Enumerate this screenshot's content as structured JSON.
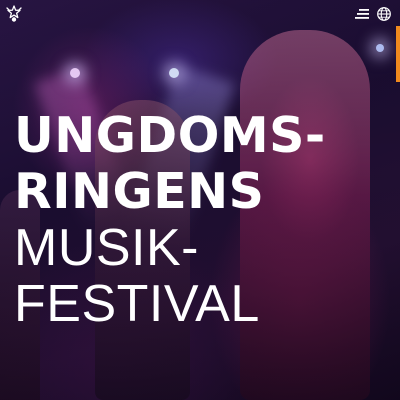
{
  "hero": {
    "title_lines": {
      "line1": "UNGDOMS-",
      "line2": "RINGENS",
      "line3": "MUSIK-",
      "line4": "FESTIVAL"
    }
  },
  "header": {
    "logo_icon": "star-emblem-icon",
    "menu_icon": "hamburger-menu-icon",
    "language_icon": "globe-icon"
  },
  "colors": {
    "accent": "#f08a1e",
    "text": "#ffffff",
    "background": "#1a0d30"
  }
}
